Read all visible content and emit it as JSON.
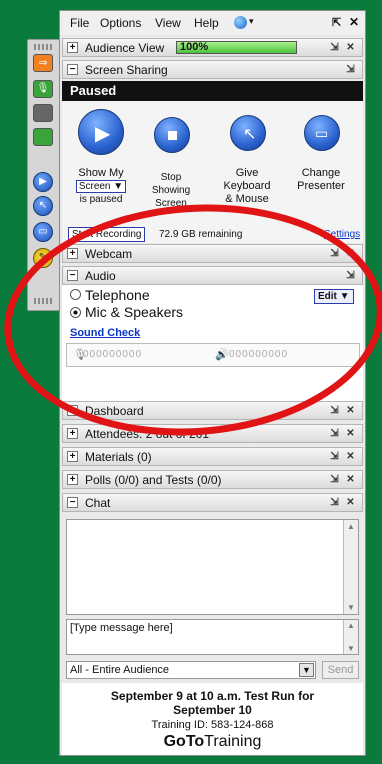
{
  "menu": {
    "file": "File",
    "options": "Options",
    "view": "View",
    "help": "Help"
  },
  "audience_view": {
    "label": "Audience View",
    "percent": "100%"
  },
  "screen_sharing": {
    "label": "Screen Sharing",
    "status": "Paused",
    "show_my": {
      "line1": "Show My",
      "select": "Screen ▼",
      "line3": "is paused"
    },
    "stop_showing": {
      "line1": "Stop",
      "line2": "Showing",
      "line3": "Screen"
    },
    "give_keyboard": {
      "line1": "Give",
      "line2": "Keyboard",
      "line3": "& Mouse"
    },
    "change_presenter": {
      "line1": "Change",
      "line2": "Presenter"
    },
    "start_recording": "Start Recording",
    "remaining": "72.9 GB remaining",
    "settings": "Settings"
  },
  "webcam": {
    "label": "Webcam"
  },
  "audio": {
    "label": "Audio",
    "telephone": "Telephone",
    "mic": "Mic & Speakers",
    "edit": "Edit ▼",
    "sound_check": "Sound Check",
    "mic_level": "000000000",
    "speaker_level": "000000000"
  },
  "dashboard": {
    "label": "Dashboard"
  },
  "attendees": {
    "label": "Attendees:  2 out of 201"
  },
  "materials": {
    "label": "Materials (0)"
  },
  "polls": {
    "label": "Polls (0/0) and Tests (0/0)"
  },
  "chat": {
    "label": "Chat",
    "placeholder": "[Type message here]",
    "audience": "All - Entire Audience",
    "send": "Send"
  },
  "footer": {
    "title1": "September 9 at 10 a.m. Test Run for",
    "title2": "September 10",
    "training_id": "Training ID: 583-124-868",
    "brand_bold": "GoTo",
    "brand_light": "Training"
  },
  "colors": {
    "background": "#0b7a3d",
    "annotation": "#e01414",
    "accent": "#2a62cf"
  }
}
